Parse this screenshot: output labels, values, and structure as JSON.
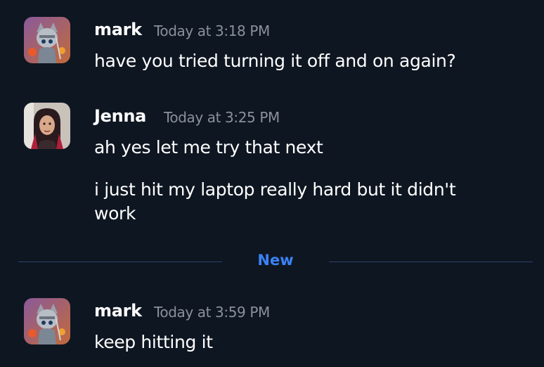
{
  "messages": [
    {
      "author": "mark",
      "timestamp": "Today at 3:18 PM",
      "avatar_icon": "knight-cat-avatar",
      "lines": [
        "have you tried turning it off and on again?"
      ]
    },
    {
      "author": "Jenna",
      "timestamp": "Today at 3:25 PM",
      "avatar_icon": "person-photo-avatar",
      "lines": [
        "ah yes let me try that next",
        "i just hit my laptop really hard but it didn't work"
      ]
    },
    {
      "author": "mark",
      "timestamp": "Today at 3:59 PM",
      "avatar_icon": "knight-cat-avatar",
      "lines": [
        "keep hitting it"
      ]
    }
  ],
  "divider": {
    "label": "New",
    "color": "#3b82f6"
  },
  "colors": {
    "background": "#0e1621",
    "timestamp": "#8a919b",
    "divider_line": "#2a4468"
  }
}
